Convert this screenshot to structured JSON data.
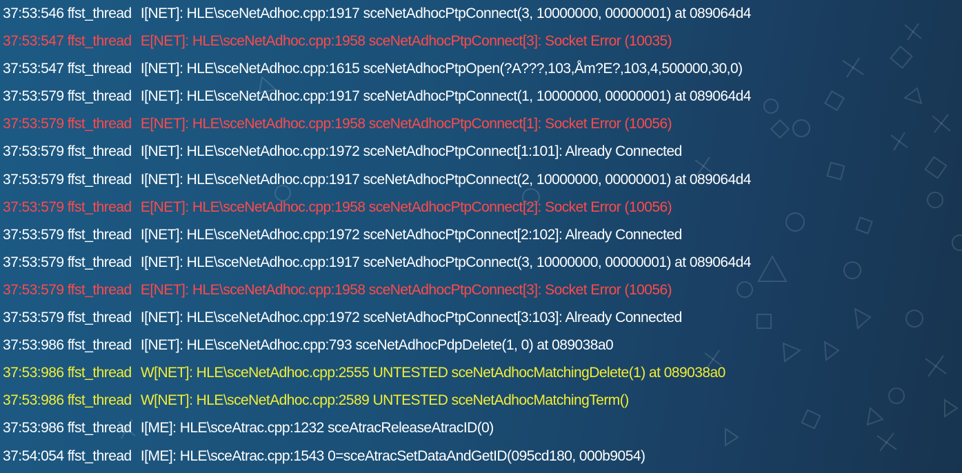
{
  "log": {
    "levels": {
      "info": {
        "color": "#ffffff"
      },
      "error": {
        "color": "#ff4a4a"
      },
      "warning": {
        "color": "#f2ee35"
      }
    },
    "lines": [
      {
        "level": "info",
        "time": "37:53:546",
        "thread": "ffst_thread",
        "message": "I[NET]: HLE\\sceNetAdhoc.cpp:1917 sceNetAdhocPtpConnect(3, 10000000, 00000001) at 089064d4"
      },
      {
        "level": "error",
        "time": "37:53:547",
        "thread": "ffst_thread",
        "message": "E[NET]: HLE\\sceNetAdhoc.cpp:1958 sceNetAdhocPtpConnect[3]: Socket Error (10035)"
      },
      {
        "level": "info",
        "time": "37:53:547",
        "thread": "ffst_thread",
        "message": "I[NET]: HLE\\sceNetAdhoc.cpp:1615 sceNetAdhocPtpOpen(?A???,103,Åm?E?,103,4,500000,30,0)"
      },
      {
        "level": "info",
        "time": "37:53:579",
        "thread": "ffst_thread",
        "message": "I[NET]: HLE\\sceNetAdhoc.cpp:1917 sceNetAdhocPtpConnect(1, 10000000, 00000001) at 089064d4"
      },
      {
        "level": "error",
        "time": "37:53:579",
        "thread": "ffst_thread",
        "message": "E[NET]: HLE\\sceNetAdhoc.cpp:1958 sceNetAdhocPtpConnect[1]: Socket Error (10056)"
      },
      {
        "level": "info",
        "time": "37:53:579",
        "thread": "ffst_thread",
        "message": "I[NET]: HLE\\sceNetAdhoc.cpp:1972 sceNetAdhocPtpConnect[1:101]: Already Connected"
      },
      {
        "level": "info",
        "time": "37:53:579",
        "thread": "ffst_thread",
        "message": "I[NET]: HLE\\sceNetAdhoc.cpp:1917 sceNetAdhocPtpConnect(2, 10000000, 00000001) at 089064d4"
      },
      {
        "level": "error",
        "time": "37:53:579",
        "thread": "ffst_thread",
        "message": "E[NET]: HLE\\sceNetAdhoc.cpp:1958 sceNetAdhocPtpConnect[2]: Socket Error (10056)"
      },
      {
        "level": "info",
        "time": "37:53:579",
        "thread": "ffst_thread",
        "message": "I[NET]: HLE\\sceNetAdhoc.cpp:1972 sceNetAdhocPtpConnect[2:102]: Already Connected"
      },
      {
        "level": "info",
        "time": "37:53:579",
        "thread": "ffst_thread",
        "message": "I[NET]: HLE\\sceNetAdhoc.cpp:1917 sceNetAdhocPtpConnect(3, 10000000, 00000001) at 089064d4"
      },
      {
        "level": "error",
        "time": "37:53:579",
        "thread": "ffst_thread",
        "message": "E[NET]: HLE\\sceNetAdhoc.cpp:1958 sceNetAdhocPtpConnect[3]: Socket Error (10056)"
      },
      {
        "level": "info",
        "time": "37:53:579",
        "thread": "ffst_thread",
        "message": "I[NET]: HLE\\sceNetAdhoc.cpp:1972 sceNetAdhocPtpConnect[3:103]: Already Connected"
      },
      {
        "level": "info",
        "time": "37:53:986",
        "thread": "ffst_thread",
        "message": "I[NET]: HLE\\sceNetAdhoc.cpp:793 sceNetAdhocPdpDelete(1, 0) at 089038a0"
      },
      {
        "level": "warning",
        "time": "37:53:986",
        "thread": "ffst_thread",
        "message": "W[NET]: HLE\\sceNetAdhoc.cpp:2555 UNTESTED sceNetAdhocMatchingDelete(1) at 089038a0"
      },
      {
        "level": "warning",
        "time": "37:53:986",
        "thread": "ffst_thread",
        "message": "W[NET]: HLE\\sceNetAdhoc.cpp:2589 UNTESTED sceNetAdhocMatchingTerm()"
      },
      {
        "level": "info",
        "time": "37:53:986",
        "thread": "ffst_thread",
        "message": "I[ME]: HLE\\sceAtrac.cpp:1232 sceAtracReleaseAtracID(0)"
      },
      {
        "level": "info",
        "time": "37:54:054",
        "thread": "ffst_thread",
        "message": "I[ME]: HLE\\sceAtrac.cpp:1543 0=sceAtracSetDataAndGetID(095cd180, 000b9054)"
      }
    ]
  },
  "background": {
    "icons": [
      "cross-icon",
      "circle-icon",
      "square-icon",
      "triangle-icon"
    ]
  }
}
